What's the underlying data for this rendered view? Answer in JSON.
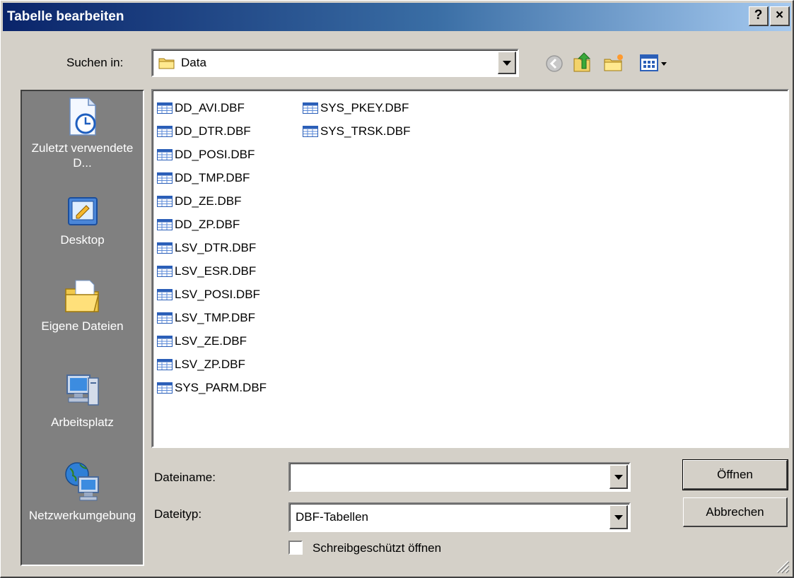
{
  "window": {
    "title": "Tabelle bearbeiten",
    "help_label": "?",
    "close_label": "×"
  },
  "search": {
    "label": "Suchen in:",
    "value": "Data"
  },
  "places": [
    {
      "label": "Zuletzt verwendete D...",
      "icon": "recent-documents-icon"
    },
    {
      "label": "Desktop",
      "icon": "desktop-icon"
    },
    {
      "label": "Eigene Dateien",
      "icon": "my-documents-icon"
    },
    {
      "label": "Arbeitsplatz",
      "icon": "my-computer-icon"
    },
    {
      "label": "Netzwerkumgebung",
      "icon": "network-icon"
    }
  ],
  "files": {
    "column1": [
      "DD_AVI.DBF",
      "DD_DTR.DBF",
      "DD_POSI.DBF",
      "DD_TMP.DBF",
      "DD_ZE.DBF",
      "DD_ZP.DBF",
      "LSV_DTR.DBF",
      "LSV_ESR.DBF",
      "LSV_POSI.DBF",
      "LSV_TMP.DBF",
      "LSV_ZE.DBF",
      "LSV_ZP.DBF",
      "SYS_PARM.DBF"
    ],
    "column2": [
      "SYS_PKEY.DBF",
      "SYS_TRSK.DBF"
    ]
  },
  "filename": {
    "label": "Dateiname:",
    "value": ""
  },
  "filetype": {
    "label": "Dateityp:",
    "value": "DBF-Tabellen"
  },
  "readonly": {
    "label": "Schreibgeschützt öffnen",
    "checked": false
  },
  "buttons": {
    "open": "Öffnen",
    "cancel": "Abbrechen"
  }
}
